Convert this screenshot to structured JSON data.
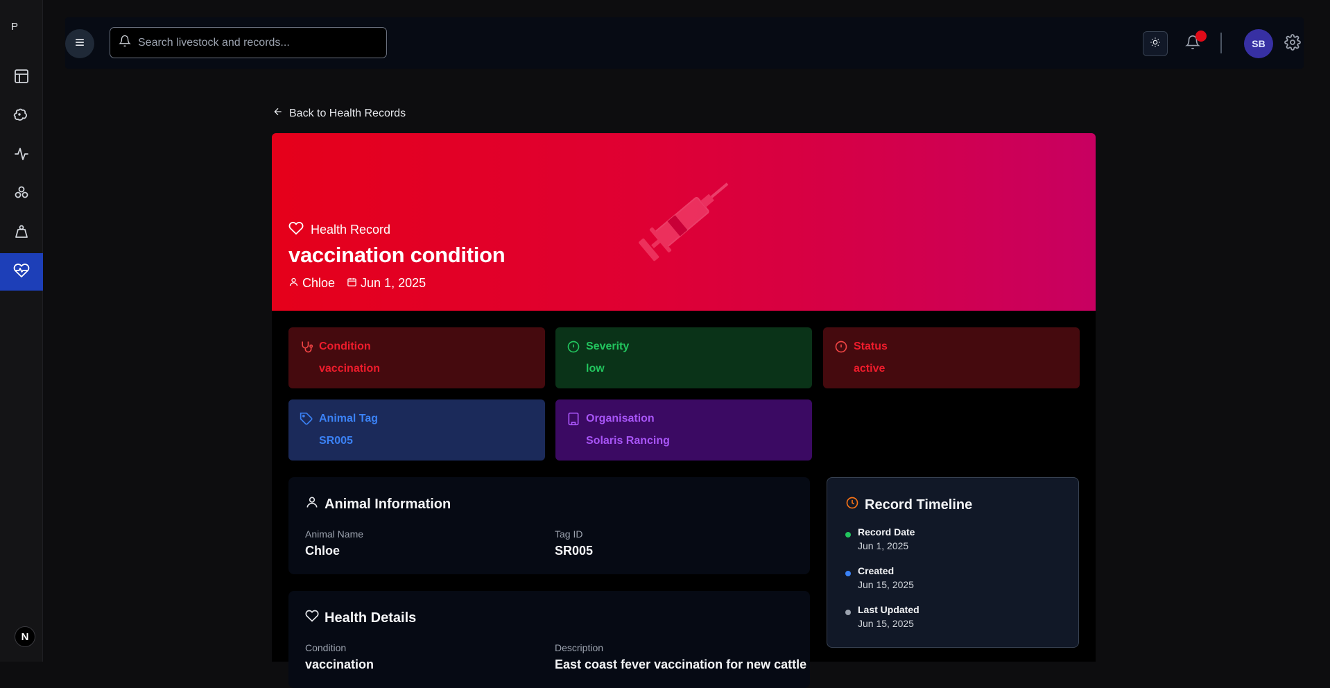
{
  "sidebar": {
    "brand": "P",
    "items": [
      {
        "name": "dashboard-icon"
      },
      {
        "name": "livestock-icon"
      },
      {
        "name": "activity-icon"
      },
      {
        "name": "groups-icon"
      },
      {
        "name": "weight-icon"
      },
      {
        "name": "health-icon",
        "active": true
      }
    ],
    "footer_logo": "N"
  },
  "topbar": {
    "search_placeholder": "Search livestock and records...",
    "avatar_initials": "SB",
    "notification_color": "#e00b18"
  },
  "back_link": "Back to Health Records",
  "hero": {
    "kicker": "Health Record",
    "title": "vaccination condition",
    "animal": "Chloe",
    "date": "Jun 1, 2025"
  },
  "stats": {
    "condition": {
      "label": "Condition",
      "value": "vaccination"
    },
    "severity": {
      "label": "Severity",
      "value": "low"
    },
    "status": {
      "label": "Status",
      "value": "active"
    },
    "animal_tag": {
      "label": "Animal Tag",
      "value": "SR005"
    },
    "organisation": {
      "label": "Organisation",
      "value": "Solaris Rancing"
    }
  },
  "animal_info": {
    "title": "Animal Information",
    "name_label": "Animal Name",
    "name_value": "Chloe",
    "tag_label": "Tag ID",
    "tag_value": "SR005"
  },
  "health_details": {
    "title": "Health Details",
    "condition_label": "Condition",
    "condition_value": "vaccination",
    "description_label": "Description",
    "description_value": "East coast fever vaccination for new cattle"
  },
  "timeline": {
    "title": "Record Timeline",
    "items": [
      {
        "label": "Record Date",
        "date": "Jun 1, 2025",
        "color": "#22c55e"
      },
      {
        "label": "Created",
        "date": "Jun 15, 2025",
        "color": "#3b82f6"
      },
      {
        "label": "Last Updated",
        "date": "Jun 15, 2025",
        "color": "#9ca3af"
      }
    ]
  },
  "colors": {
    "accent": "#1d3fb8",
    "hero_start": "#e5001a",
    "hero_end": "#c80061"
  }
}
